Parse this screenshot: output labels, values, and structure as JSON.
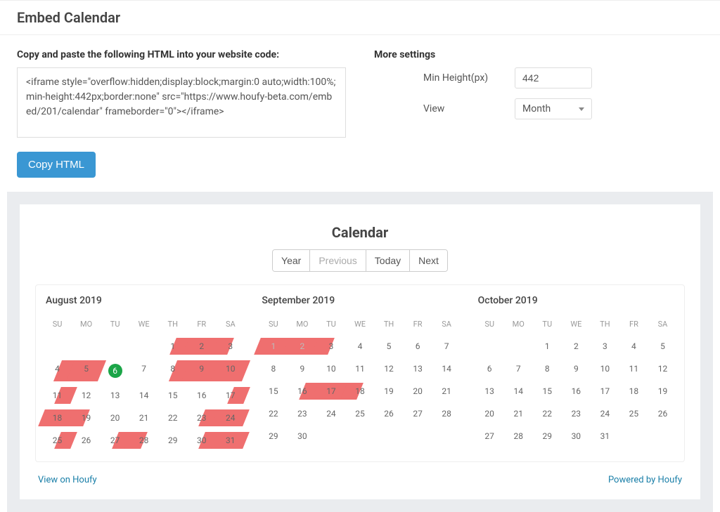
{
  "page_title": "Embed Calendar",
  "copy_paste_label": "Copy and paste the following HTML into your website code:",
  "iframe_code": "<iframe style=\"overflow:hidden;display:block;margin:0 auto;width:100%;min-height:442px;border:none\" src=\"https://www.houfy-beta.com/embed/201/calendar\" frameborder=\"0\"></iframe>",
  "copy_button": "Copy HTML",
  "more_settings": {
    "title": "More settings",
    "min_height_label": "Min Height(px)",
    "min_height_value": "442",
    "view_label": "View",
    "view_value": "Month"
  },
  "calendar": {
    "title": "Calendar",
    "controls": {
      "year": "Year",
      "prev": "Previous",
      "today": "Today",
      "next": "Next"
    },
    "weekdays": [
      "SU",
      "MO",
      "TU",
      "WE",
      "TH",
      "FR",
      "SA"
    ],
    "today_date": "2019-08-06",
    "months": [
      {
        "label": "August 2019",
        "weeks": [
          [
            null,
            null,
            null,
            null,
            {
              "d": 1,
              "b": "right"
            },
            {
              "d": 2,
              "b": "full"
            },
            {
              "d": 3,
              "b": "left"
            }
          ],
          [
            {
              "d": 4,
              "b": "right"
            },
            {
              "d": 5,
              "b": "full"
            },
            {
              "d": 6,
              "b": "none",
              "today": true
            },
            {
              "d": 7
            },
            {
              "d": 8,
              "b": "right"
            },
            {
              "d": 9,
              "b": "full"
            },
            {
              "d": 10,
              "b": "full"
            }
          ],
          [
            {
              "d": 11,
              "b": "right"
            },
            {
              "d": 12
            },
            {
              "d": 13
            },
            {
              "d": 14
            },
            {
              "d": 15
            },
            {
              "d": 16
            },
            {
              "d": 17,
              "b": "right"
            }
          ],
          [
            {
              "d": 18,
              "b": "full"
            },
            {
              "d": 19,
              "b": "left"
            },
            {
              "d": 20
            },
            {
              "d": 21
            },
            {
              "d": 22
            },
            {
              "d": 23,
              "b": "right"
            },
            {
              "d": 24,
              "b": "full"
            }
          ],
          [
            {
              "d": 25,
              "b": "right"
            },
            {
              "d": 26
            },
            {
              "d": 27,
              "b": "right"
            },
            {
              "d": 28,
              "b": "left"
            },
            {
              "d": 29
            },
            {
              "d": 30,
              "b": "right"
            },
            {
              "d": 31,
              "b": "full"
            }
          ]
        ]
      },
      {
        "label": "September 2019",
        "weeks": [
          [
            {
              "d": 1,
              "b": "full",
              "muted": true
            },
            {
              "d": 2,
              "b": "full",
              "muted": true
            },
            {
              "d": 3,
              "b": "left"
            },
            {
              "d": 4
            },
            {
              "d": 5
            },
            {
              "d": 6
            },
            {
              "d": 7
            }
          ],
          [
            {
              "d": 8
            },
            {
              "d": 9
            },
            {
              "d": 10
            },
            {
              "d": 11
            },
            {
              "d": 12
            },
            {
              "d": 13
            },
            {
              "d": 14
            }
          ],
          [
            {
              "d": 15
            },
            {
              "d": 16,
              "b": "right"
            },
            {
              "d": 17,
              "b": "full"
            },
            {
              "d": 18,
              "b": "left"
            },
            {
              "d": 19
            },
            {
              "d": 20
            },
            {
              "d": 21
            }
          ],
          [
            {
              "d": 22
            },
            {
              "d": 23
            },
            {
              "d": 24
            },
            {
              "d": 25
            },
            {
              "d": 26
            },
            {
              "d": 27
            },
            {
              "d": 28
            }
          ],
          [
            {
              "d": 29
            },
            {
              "d": 30
            },
            null,
            null,
            null,
            null,
            null
          ]
        ]
      },
      {
        "label": "October 2019",
        "weeks": [
          [
            null,
            null,
            {
              "d": 1
            },
            {
              "d": 2
            },
            {
              "d": 3
            },
            {
              "d": 4
            },
            {
              "d": 5
            }
          ],
          [
            {
              "d": 6
            },
            {
              "d": 7
            },
            {
              "d": 8
            },
            {
              "d": 9
            },
            {
              "d": 10
            },
            {
              "d": 11
            },
            {
              "d": 12
            }
          ],
          [
            {
              "d": 13
            },
            {
              "d": 14
            },
            {
              "d": 15
            },
            {
              "d": 16
            },
            {
              "d": 17
            },
            {
              "d": 18
            },
            {
              "d": 19
            }
          ],
          [
            {
              "d": 20
            },
            {
              "d": 21
            },
            {
              "d": 22
            },
            {
              "d": 23
            },
            {
              "d": 24
            },
            {
              "d": 25
            },
            {
              "d": 26
            }
          ],
          [
            {
              "d": 27
            },
            {
              "d": 28
            },
            {
              "d": 29
            },
            {
              "d": 30
            },
            {
              "d": 31
            },
            null,
            null
          ]
        ]
      }
    ],
    "footer": {
      "view_on": "View on Houfy",
      "powered_by": "Powered by Houfy"
    }
  }
}
